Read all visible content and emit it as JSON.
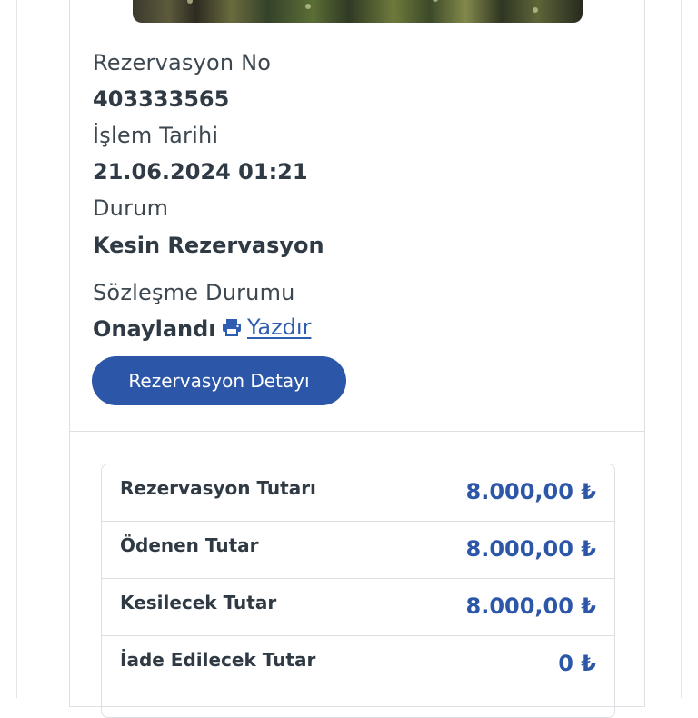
{
  "reservation": {
    "no_label": "Rezervasyon No",
    "no_value": "403333565",
    "date_label": "İşlem Tarihi",
    "date_value": "21.06.2024 01:21",
    "status_label": "Durum",
    "status_value": "Kesin Rezervasyon",
    "contract_label": "Sözleşme Durumu",
    "contract_value": "Onaylandı",
    "print_label": "Yazdır",
    "detail_button": "Rezervasyon Detayı"
  },
  "amounts": [
    {
      "label": "Rezervasyon Tutarı",
      "value": "8.000,00 ₺"
    },
    {
      "label": "Ödenen Tutar",
      "value": "8.000,00 ₺"
    },
    {
      "label": "Kesilecek Tutar",
      "value": "8.000,00 ₺"
    },
    {
      "label": "İade Edilecek Tutar",
      "value": "0 ₺"
    }
  ],
  "icons": {
    "print": "printer-icon"
  },
  "colors": {
    "accent": "#2c56a8",
    "link": "#2f5db0"
  }
}
